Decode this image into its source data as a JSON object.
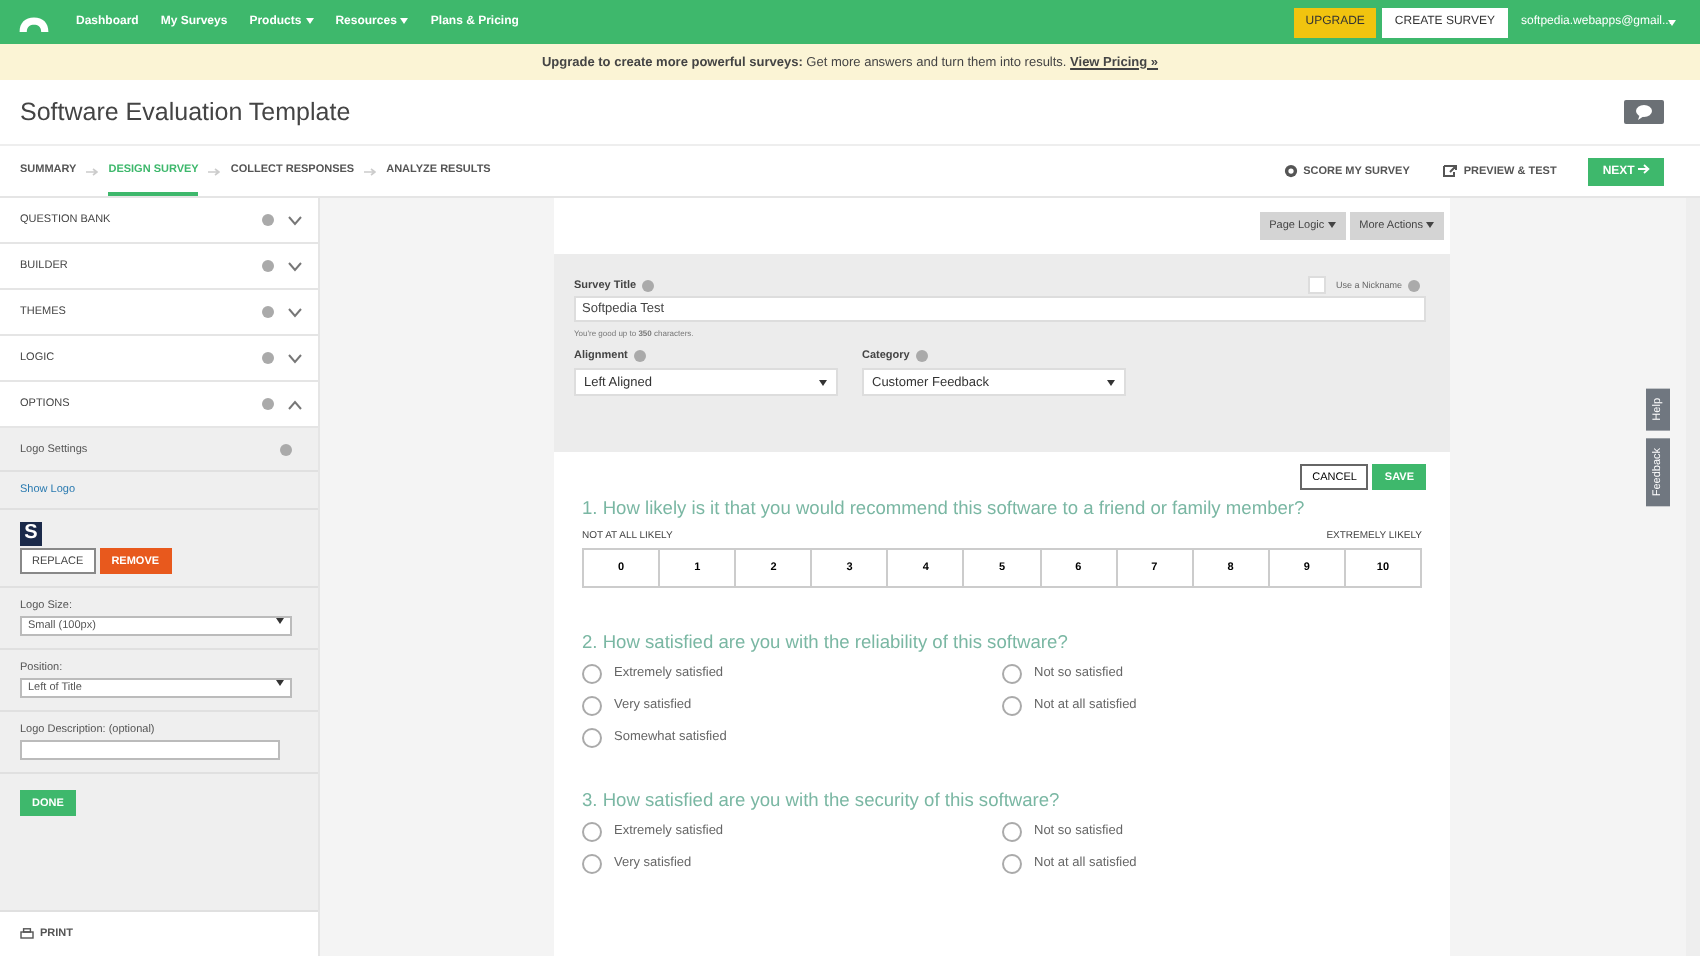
{
  "nav": {
    "links": [
      {
        "label": "Dashboard",
        "dropdown": false
      },
      {
        "label": "My Surveys",
        "dropdown": false
      },
      {
        "label": "Products",
        "dropdown": true
      },
      {
        "label": "Resources",
        "dropdown": true
      },
      {
        "label": "Plans & Pricing",
        "dropdown": false
      }
    ],
    "upgrade": "UPGRADE",
    "create": "CREATE SURVEY",
    "account": "softpedia.webapps@gmail..."
  },
  "banner": {
    "lead": "Upgrade to create more powerful surveys:",
    "text": "Get more answers and turn them into results.",
    "link": "View Pricing »"
  },
  "title": "Software Evaluation Template",
  "steps": [
    {
      "label": "SUMMARY",
      "selected": false
    },
    {
      "label": "DESIGN SURVEY",
      "selected": true
    },
    {
      "label": "COLLECT RESPONSES",
      "selected": false
    },
    {
      "label": "ANALYZE RESULTS",
      "selected": false
    }
  ],
  "actions": {
    "score": "SCORE MY SURVEY",
    "preview": "PREVIEW & TEST",
    "next": "NEXT"
  },
  "sidebar": {
    "sections": [
      {
        "label": "QUESTION BANK",
        "expanded": false
      },
      {
        "label": "BUILDER",
        "expanded": false
      },
      {
        "label": "THEMES",
        "expanded": false
      },
      {
        "label": "LOGIC",
        "expanded": false
      },
      {
        "label": "OPTIONS",
        "expanded": true
      }
    ],
    "logo_settings": "Logo Settings",
    "show_logo": "Show Logo",
    "logo_letter": "S",
    "replace": "REPLACE",
    "remove": "REMOVE",
    "logo_size": {
      "label": "Logo Size:",
      "value": "Small (100px)"
    },
    "position": {
      "label": "Position:",
      "value": "Left of Title"
    },
    "description": {
      "label": "Logo Description: (optional)"
    },
    "done": "DONE",
    "print": "PRINT"
  },
  "toolbar": {
    "page_logic": "Page Logic",
    "more_actions": "More Actions"
  },
  "editor": {
    "title_label": "Survey Title",
    "title_value": "Softpedia Test",
    "hint": "You're good up to **350** characters.",
    "nickname": {
      "label": "Use a Nickname",
      "checked": false
    },
    "alignment": {
      "label": "Alignment",
      "value": "Left Aligned"
    },
    "category": {
      "label": "Category",
      "value": "Customer Feedback"
    },
    "cancel": "CANCEL",
    "save": "SAVE"
  },
  "questions": [
    {
      "kind": "scale",
      "title": "1. How likely is it that you would recommend this software to a friend or family member?",
      "low": "NOT AT ALL LIKELY",
      "high": "EXTREMELY LIKELY",
      "options": [
        "0",
        "1",
        "2",
        "3",
        "4",
        "5",
        "6",
        "7",
        "8",
        "9",
        "10"
      ]
    },
    {
      "kind": "choice",
      "title": "2. How satisfied are you with the reliability of this software?",
      "columns": [
        [
          "Extremely satisfied",
          "Very satisfied",
          "Somewhat satisfied"
        ],
        [
          "Not so satisfied",
          "Not at all satisfied"
        ]
      ]
    },
    {
      "kind": "choice",
      "title": "3. How satisfied are you with the security of this software?",
      "columns": [
        [
          "Extremely satisfied",
          "Very satisfied"
        ],
        [
          "Not so satisfied",
          "Not at all satisfied"
        ]
      ]
    }
  ],
  "side_tabs": [
    "Help",
    "Feedback"
  ]
}
